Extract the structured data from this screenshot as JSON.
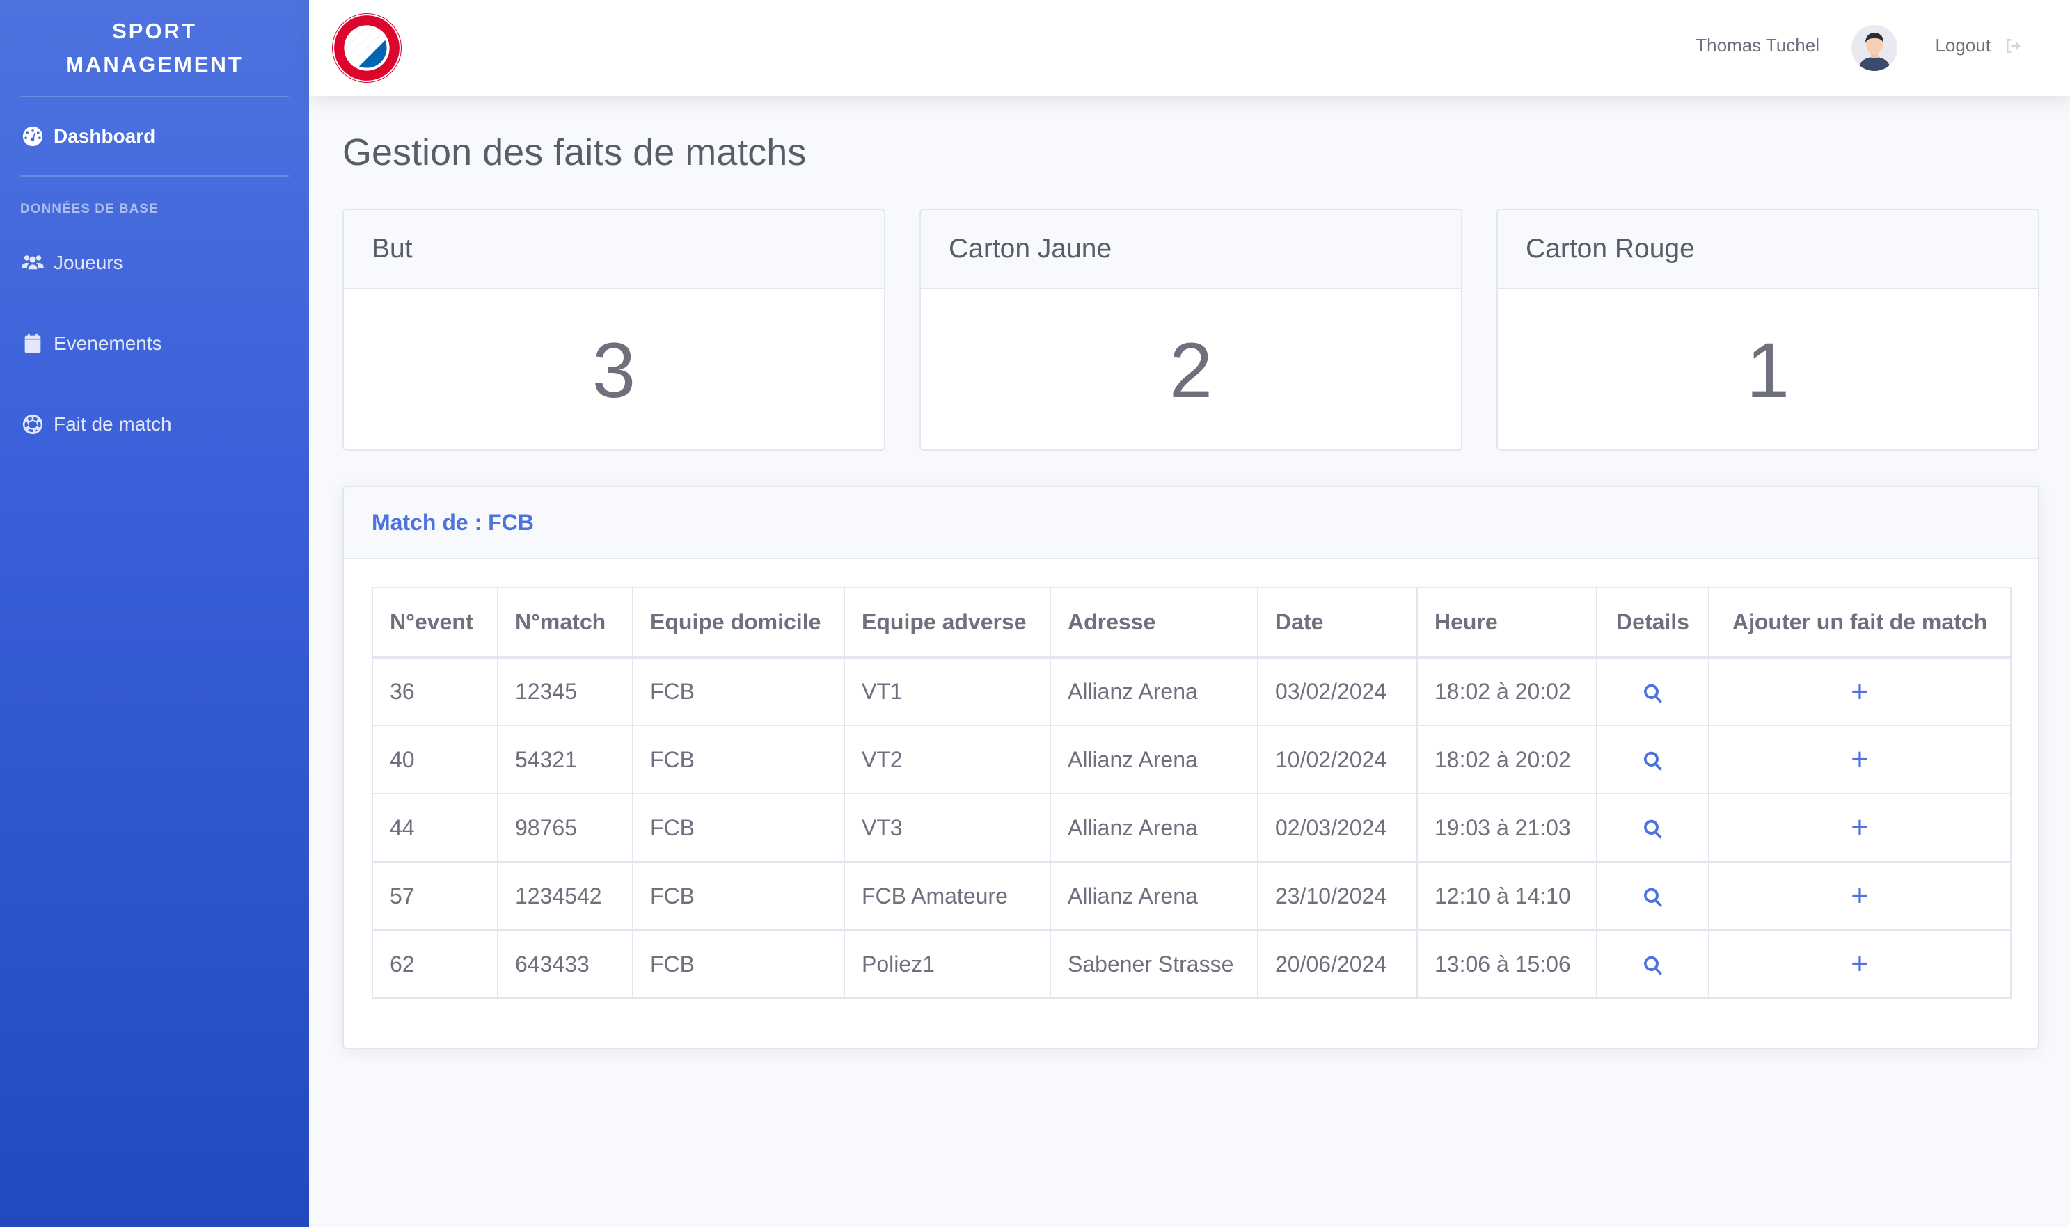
{
  "sidebar": {
    "brand_line1": "SPORT",
    "brand_line2": "MANAGEMENT",
    "dashboard": "Dashboard",
    "section_heading": "DONNÉES DE BASE",
    "items": [
      {
        "label": "Joueurs",
        "icon": "users-icon"
      },
      {
        "label": "Evenements",
        "icon": "calendar-icon"
      },
      {
        "label": "Fait de match",
        "icon": "soccer-ball-icon"
      }
    ]
  },
  "topbar": {
    "user_name": "Thomas Tuchel",
    "logout": "Logout"
  },
  "page": {
    "title": "Gestion des faits de matchs"
  },
  "stats": [
    {
      "label": "But",
      "value": "3"
    },
    {
      "label": "Carton Jaune",
      "value": "2"
    },
    {
      "label": "Carton Rouge",
      "value": "1"
    }
  ],
  "table_card": {
    "title": "Match de : FCB",
    "columns": [
      "N°event",
      "N°match",
      "Equipe domicile",
      "Equipe adverse",
      "Adresse",
      "Date",
      "Heure",
      "Details",
      "Ajouter un fait de match"
    ],
    "rows": [
      {
        "event": "36",
        "match": "12345",
        "home": "FCB",
        "away": "VT1",
        "address": "Allianz Arena",
        "date": "03/02/2024",
        "time": "18:02 à 20:02"
      },
      {
        "event": "40",
        "match": "54321",
        "home": "FCB",
        "away": "VT2",
        "address": "Allianz Arena",
        "date": "10/02/2024",
        "time": "18:02 à 20:02"
      },
      {
        "event": "44",
        "match": "98765",
        "home": "FCB",
        "away": "VT3",
        "address": "Allianz Arena",
        "date": "02/03/2024",
        "time": "19:03 à 21:03"
      },
      {
        "event": "57",
        "match": "1234542",
        "home": "FCB",
        "away": "FCB Amateure",
        "address": "Allianz Arena",
        "date": "23/10/2024",
        "time": "12:10 à 14:10"
      },
      {
        "event": "62",
        "match": "643433",
        "home": "FCB",
        "away": "Poliez1",
        "address": "Sabener Strasse",
        "date": "20/06/2024",
        "time": "13:06 à 15:06"
      }
    ],
    "add_symbol": "+"
  },
  "colors": {
    "primary": "#4e73df",
    "sidebar_bottom": "#224abe",
    "text": "#5a5c69"
  }
}
